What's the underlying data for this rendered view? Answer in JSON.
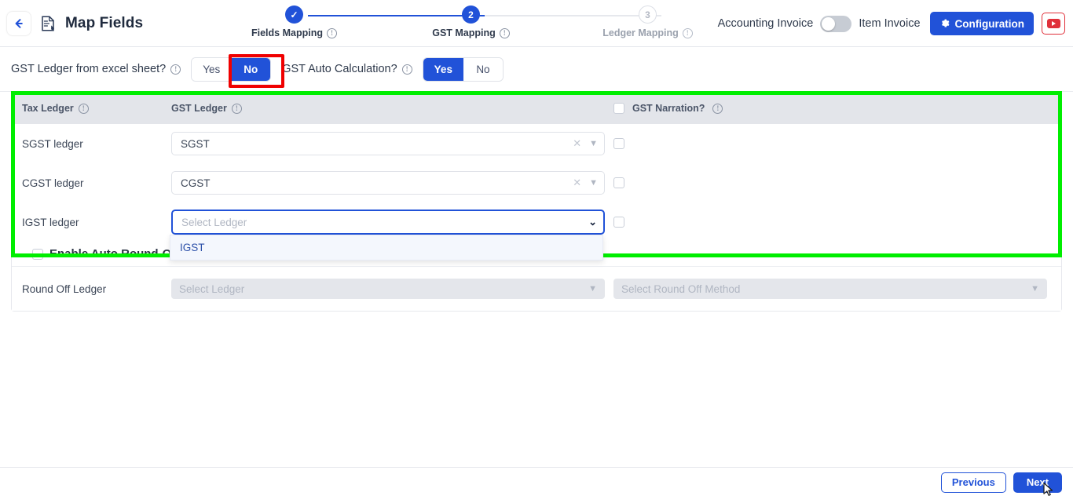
{
  "header": {
    "back_icon": "arrow-left-icon",
    "doc_icon": "document-edit-icon",
    "title": "Map Fields",
    "accounting_invoice_label": "Accounting Invoice",
    "item_invoice_label": "Item Invoice",
    "toggle_state": "off",
    "configuration_label": "Configuration",
    "gear_icon": "gear-icon",
    "youtube_icon": "youtube-icon"
  },
  "stepper": {
    "steps": [
      {
        "number": "1",
        "marker": "✓",
        "label": "Fields Mapping",
        "state": "done"
      },
      {
        "number": "2",
        "marker": "2",
        "label": "GST Mapping",
        "state": "active"
      },
      {
        "number": "3",
        "marker": "3",
        "label": "Ledger Mapping",
        "state": "todo"
      }
    ]
  },
  "options": {
    "gst_ledger_question": "GST Ledger from excel sheet?",
    "gst_ledger_yes": "Yes",
    "gst_ledger_no": "No",
    "gst_ledger_selected": "No",
    "gst_auto_question": "GST Auto Calculation?",
    "gst_auto_yes": "Yes",
    "gst_auto_no": "No",
    "gst_auto_selected": "Yes"
  },
  "table": {
    "headers": {
      "tax_ledger": "Tax Ledger",
      "gst_ledger": "GST Ledger",
      "gst_narration": "GST Narration?"
    },
    "rows": [
      {
        "label": "SGST ledger",
        "value": "SGST",
        "placeholder": "Select Ledger",
        "narration_checked": false
      },
      {
        "label": "CGST ledger",
        "value": "CGST",
        "placeholder": "Select Ledger",
        "narration_checked": false
      },
      {
        "label": "IGST ledger",
        "value": "",
        "placeholder": "Select Ledger",
        "narration_checked": false
      }
    ]
  },
  "dropdown": {
    "open": true,
    "options": [
      "IGST"
    ]
  },
  "roundoff": {
    "enable_label": "Enable Auto Round-Off.",
    "enabled": false,
    "ledger_label": "Round Off Ledger",
    "ledger_placeholder": "Select Ledger",
    "method_placeholder": "Select Round Off Method"
  },
  "footer": {
    "previous_label": "Previous",
    "next_label": "Next"
  },
  "annotations": {
    "red_highlight_target": "No",
    "green_highlight_target": "gst-mapping-table",
    "accent_blue": "#2152d8",
    "highlight_red": "#f00000",
    "highlight_green": "#00ee00"
  }
}
